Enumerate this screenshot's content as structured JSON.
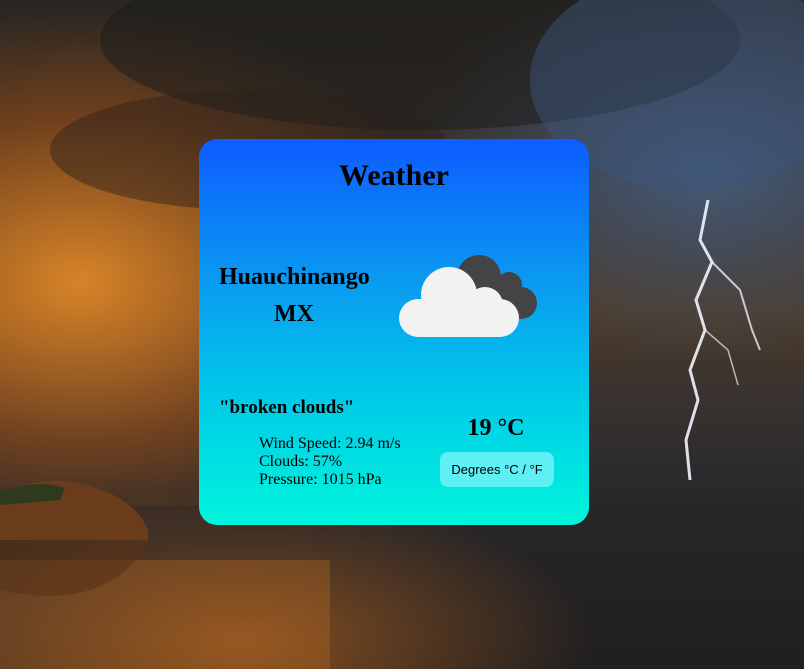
{
  "app": {
    "title": "Weather"
  },
  "location": {
    "city": "Huauchinango",
    "country": "MX"
  },
  "weather": {
    "icon": "broken-clouds-icon",
    "description": "\"broken clouds\"",
    "wind_speed": "Wind Speed: 2.94 m/s",
    "clouds": "Clouds: 57%",
    "pressure": "Pressure: 1015 hPa",
    "temperature": "19 °C"
  },
  "controls": {
    "unit_toggle_label": "Degrees °C / °F"
  },
  "colors": {
    "card_top": "#0d5cff",
    "card_bottom": "#00f5dc",
    "button_bg": "#5ef0f4"
  }
}
